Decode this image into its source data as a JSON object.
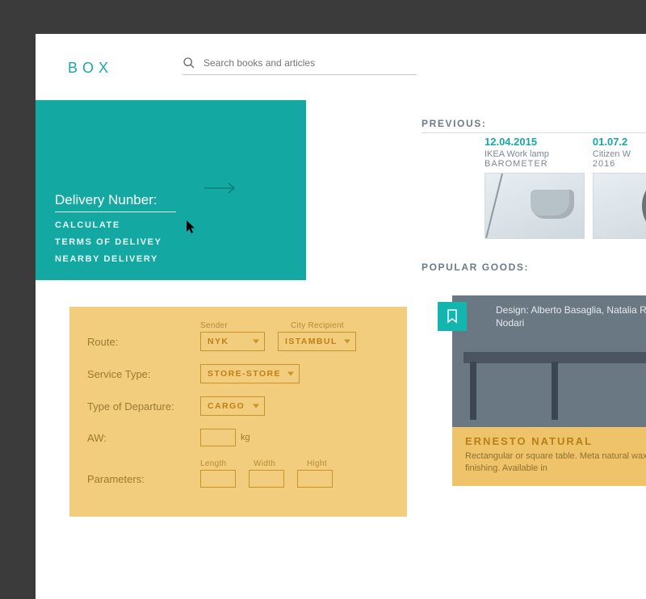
{
  "brand": "BOX",
  "search": {
    "placeholder": "Search books and articles"
  },
  "teal": {
    "delivery_placeholder": "Delivery Nunber:",
    "nav": {
      "calculate": "CALCULATE",
      "terms": "TERMS OF DELIVEY",
      "nearby": "NEARBY DELIVERY"
    }
  },
  "previous": {
    "heading": "PREVIOUS:",
    "items": [
      {
        "date": "12.04.2015",
        "line1": "IKEA Work lamp",
        "line2": "BAROMETER"
      },
      {
        "date": "01.07.2",
        "line1": "Citizen W",
        "line2": "2016"
      }
    ]
  },
  "popular": {
    "heading": "POPULAR GOODS:",
    "card": {
      "design_by": "Design: Alberto Basaglia, Natalia Rota Nodari",
      "name": "ERNESTO NATURAL",
      "desc": "Rectangular or square table. Meta\nnatural wax finishing. Available in"
    }
  },
  "form": {
    "labels": {
      "route": "Route:",
      "service": "Service Type:",
      "departure": "Type of Departure:",
      "aw": "AW:",
      "params": "Parameters:",
      "sender": "Sender",
      "recipient": "City Recipient",
      "length": "Length",
      "width": "Width",
      "height": "Hight",
      "kg": "kg"
    },
    "values": {
      "sender": "NYK",
      "recipient": "ISTAMBUL",
      "service": "STORE-STORE",
      "departure": "CARGO"
    }
  }
}
